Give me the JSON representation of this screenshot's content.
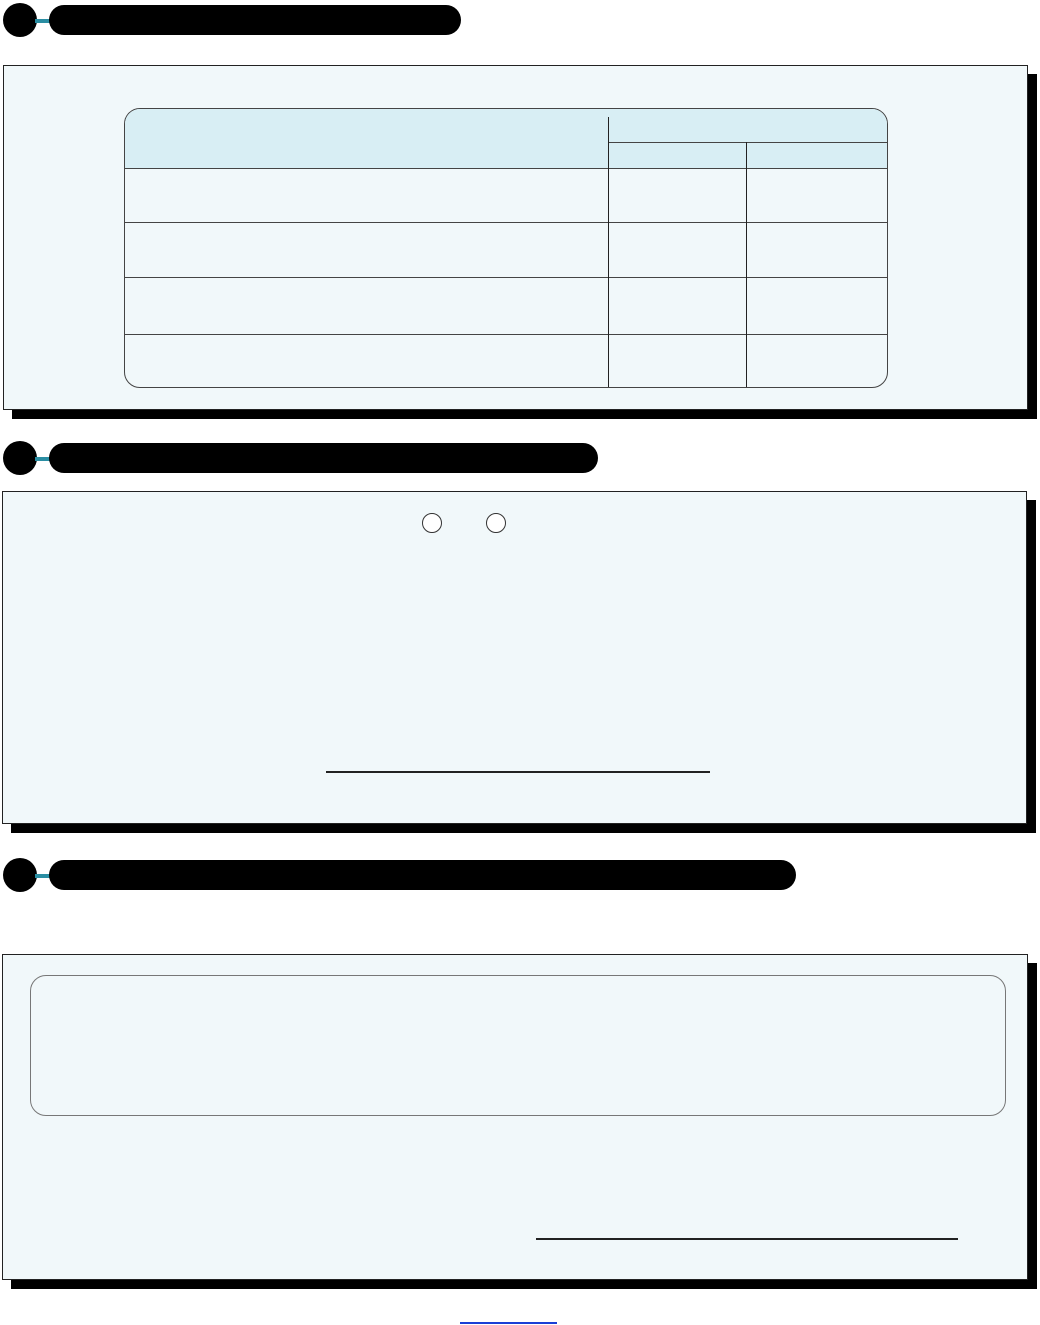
{
  "sections": [
    {
      "title": ""
    },
    {
      "title": ""
    },
    {
      "title": ""
    }
  ],
  "table": {
    "group_header": "",
    "sub_headers": [
      "",
      ""
    ],
    "rows": [
      {
        "label": "",
        "c1": "",
        "c2": ""
      },
      {
        "label": "",
        "c1": "",
        "c2": ""
      },
      {
        "label": "",
        "c1": "",
        "c2": ""
      },
      {
        "label": "",
        "c1": "",
        "c2": ""
      }
    ]
  },
  "section2": {
    "radio_labels": [
      "",
      ""
    ],
    "signature_label": ""
  },
  "section3": {
    "box_text": "",
    "signature_label": ""
  },
  "footer": {
    "link_text": ""
  },
  "colors": {
    "panel_bg": "#f1f8fa",
    "table_header_bg": "#d8eef4",
    "connector": "#2a8ea3",
    "link": "#1a3fd6"
  }
}
